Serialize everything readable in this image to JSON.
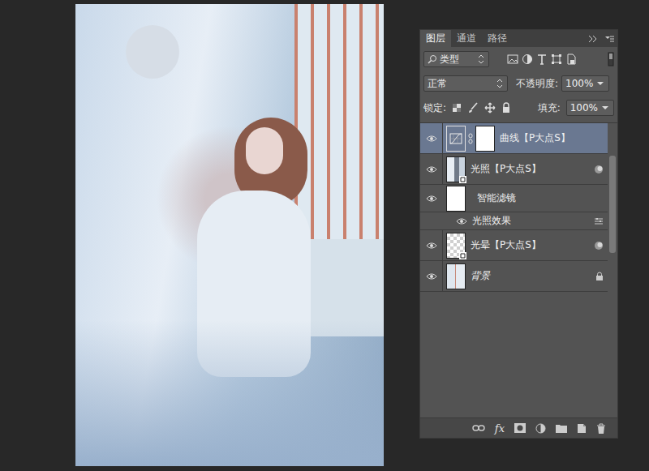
{
  "tabs": [
    {
      "label": "图层",
      "selected": true
    },
    {
      "label": "通道",
      "selected": false
    },
    {
      "label": "路径",
      "selected": false
    }
  ],
  "filter": {
    "label": "类型"
  },
  "blend_mode": "正常",
  "opacity": {
    "label": "不透明度:",
    "value": "100%"
  },
  "lock": {
    "label": "锁定:"
  },
  "fill": {
    "label": "填充:",
    "value": "100%"
  },
  "layers": [
    {
      "name": "曲线【P大点S】",
      "kind": "adjustment",
      "visible": true,
      "selected": true
    },
    {
      "name": "光照【P大点S】",
      "kind": "smart",
      "visible": true,
      "selected": false
    },
    {
      "name": "智能滤镜",
      "kind": "filtergroup",
      "visible": true,
      "selected": false
    },
    {
      "name": "光照效果",
      "kind": "filter",
      "visible": true,
      "selected": false
    },
    {
      "name": "光晕【P大点S】",
      "kind": "transparent",
      "visible": true,
      "selected": false
    },
    {
      "name": "背景",
      "kind": "background",
      "visible": true,
      "selected": false
    }
  ],
  "footer": {
    "fx": "fx"
  }
}
